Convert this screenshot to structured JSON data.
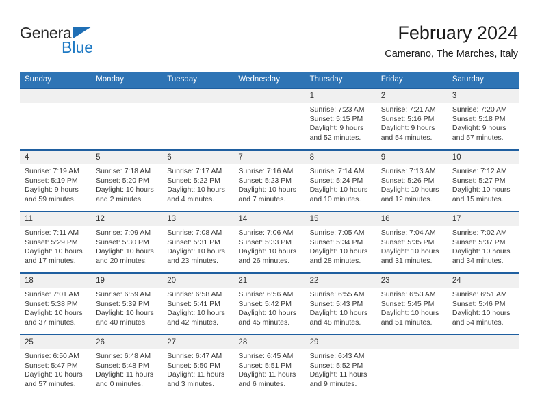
{
  "brand": {
    "line1": "General",
    "line2": "Blue",
    "triangle_icon": "triangle-icon",
    "color_dark": "#2b2b2b",
    "color_blue": "#1f7ac4"
  },
  "header": {
    "title": "February 2024",
    "subtitle": "Camerano, The Marches, Italy"
  },
  "colors": {
    "header_band": "#2e74b5",
    "week_separator": "#1f5fa0",
    "daynum_band": "#f0f0f0",
    "text": "#3a3a3a"
  },
  "weekdays": [
    "Sunday",
    "Monday",
    "Tuesday",
    "Wednesday",
    "Thursday",
    "Friday",
    "Saturday"
  ],
  "weeks": [
    [
      {
        "day": "",
        "empty": true
      },
      {
        "day": "",
        "empty": true
      },
      {
        "day": "",
        "empty": true
      },
      {
        "day": "",
        "empty": true
      },
      {
        "day": "1",
        "sunrise": "Sunrise: 7:23 AM",
        "sunset": "Sunset: 5:15 PM",
        "daylight1": "Daylight: 9 hours",
        "daylight2": "and 52 minutes."
      },
      {
        "day": "2",
        "sunrise": "Sunrise: 7:21 AM",
        "sunset": "Sunset: 5:16 PM",
        "daylight1": "Daylight: 9 hours",
        "daylight2": "and 54 minutes."
      },
      {
        "day": "3",
        "sunrise": "Sunrise: 7:20 AM",
        "sunset": "Sunset: 5:18 PM",
        "daylight1": "Daylight: 9 hours",
        "daylight2": "and 57 minutes."
      }
    ],
    [
      {
        "day": "4",
        "sunrise": "Sunrise: 7:19 AM",
        "sunset": "Sunset: 5:19 PM",
        "daylight1": "Daylight: 9 hours",
        "daylight2": "and 59 minutes."
      },
      {
        "day": "5",
        "sunrise": "Sunrise: 7:18 AM",
        "sunset": "Sunset: 5:20 PM",
        "daylight1": "Daylight: 10 hours",
        "daylight2": "and 2 minutes."
      },
      {
        "day": "6",
        "sunrise": "Sunrise: 7:17 AM",
        "sunset": "Sunset: 5:22 PM",
        "daylight1": "Daylight: 10 hours",
        "daylight2": "and 4 minutes."
      },
      {
        "day": "7",
        "sunrise": "Sunrise: 7:16 AM",
        "sunset": "Sunset: 5:23 PM",
        "daylight1": "Daylight: 10 hours",
        "daylight2": "and 7 minutes."
      },
      {
        "day": "8",
        "sunrise": "Sunrise: 7:14 AM",
        "sunset": "Sunset: 5:24 PM",
        "daylight1": "Daylight: 10 hours",
        "daylight2": "and 10 minutes."
      },
      {
        "day": "9",
        "sunrise": "Sunrise: 7:13 AM",
        "sunset": "Sunset: 5:26 PM",
        "daylight1": "Daylight: 10 hours",
        "daylight2": "and 12 minutes."
      },
      {
        "day": "10",
        "sunrise": "Sunrise: 7:12 AM",
        "sunset": "Sunset: 5:27 PM",
        "daylight1": "Daylight: 10 hours",
        "daylight2": "and 15 minutes."
      }
    ],
    [
      {
        "day": "11",
        "sunrise": "Sunrise: 7:11 AM",
        "sunset": "Sunset: 5:29 PM",
        "daylight1": "Daylight: 10 hours",
        "daylight2": "and 17 minutes."
      },
      {
        "day": "12",
        "sunrise": "Sunrise: 7:09 AM",
        "sunset": "Sunset: 5:30 PM",
        "daylight1": "Daylight: 10 hours",
        "daylight2": "and 20 minutes."
      },
      {
        "day": "13",
        "sunrise": "Sunrise: 7:08 AM",
        "sunset": "Sunset: 5:31 PM",
        "daylight1": "Daylight: 10 hours",
        "daylight2": "and 23 minutes."
      },
      {
        "day": "14",
        "sunrise": "Sunrise: 7:06 AM",
        "sunset": "Sunset: 5:33 PM",
        "daylight1": "Daylight: 10 hours",
        "daylight2": "and 26 minutes."
      },
      {
        "day": "15",
        "sunrise": "Sunrise: 7:05 AM",
        "sunset": "Sunset: 5:34 PM",
        "daylight1": "Daylight: 10 hours",
        "daylight2": "and 28 minutes."
      },
      {
        "day": "16",
        "sunrise": "Sunrise: 7:04 AM",
        "sunset": "Sunset: 5:35 PM",
        "daylight1": "Daylight: 10 hours",
        "daylight2": "and 31 minutes."
      },
      {
        "day": "17",
        "sunrise": "Sunrise: 7:02 AM",
        "sunset": "Sunset: 5:37 PM",
        "daylight1": "Daylight: 10 hours",
        "daylight2": "and 34 minutes."
      }
    ],
    [
      {
        "day": "18",
        "sunrise": "Sunrise: 7:01 AM",
        "sunset": "Sunset: 5:38 PM",
        "daylight1": "Daylight: 10 hours",
        "daylight2": "and 37 minutes."
      },
      {
        "day": "19",
        "sunrise": "Sunrise: 6:59 AM",
        "sunset": "Sunset: 5:39 PM",
        "daylight1": "Daylight: 10 hours",
        "daylight2": "and 40 minutes."
      },
      {
        "day": "20",
        "sunrise": "Sunrise: 6:58 AM",
        "sunset": "Sunset: 5:41 PM",
        "daylight1": "Daylight: 10 hours",
        "daylight2": "and 42 minutes."
      },
      {
        "day": "21",
        "sunrise": "Sunrise: 6:56 AM",
        "sunset": "Sunset: 5:42 PM",
        "daylight1": "Daylight: 10 hours",
        "daylight2": "and 45 minutes."
      },
      {
        "day": "22",
        "sunrise": "Sunrise: 6:55 AM",
        "sunset": "Sunset: 5:43 PM",
        "daylight1": "Daylight: 10 hours",
        "daylight2": "and 48 minutes."
      },
      {
        "day": "23",
        "sunrise": "Sunrise: 6:53 AM",
        "sunset": "Sunset: 5:45 PM",
        "daylight1": "Daylight: 10 hours",
        "daylight2": "and 51 minutes."
      },
      {
        "day": "24",
        "sunrise": "Sunrise: 6:51 AM",
        "sunset": "Sunset: 5:46 PM",
        "daylight1": "Daylight: 10 hours",
        "daylight2": "and 54 minutes."
      }
    ],
    [
      {
        "day": "25",
        "sunrise": "Sunrise: 6:50 AM",
        "sunset": "Sunset: 5:47 PM",
        "daylight1": "Daylight: 10 hours",
        "daylight2": "and 57 minutes."
      },
      {
        "day": "26",
        "sunrise": "Sunrise: 6:48 AM",
        "sunset": "Sunset: 5:48 PM",
        "daylight1": "Daylight: 11 hours",
        "daylight2": "and 0 minutes."
      },
      {
        "day": "27",
        "sunrise": "Sunrise: 6:47 AM",
        "sunset": "Sunset: 5:50 PM",
        "daylight1": "Daylight: 11 hours",
        "daylight2": "and 3 minutes."
      },
      {
        "day": "28",
        "sunrise": "Sunrise: 6:45 AM",
        "sunset": "Sunset: 5:51 PM",
        "daylight1": "Daylight: 11 hours",
        "daylight2": "and 6 minutes."
      },
      {
        "day": "29",
        "sunrise": "Sunrise: 6:43 AM",
        "sunset": "Sunset: 5:52 PM",
        "daylight1": "Daylight: 11 hours",
        "daylight2": "and 9 minutes."
      },
      {
        "day": "",
        "empty": true
      },
      {
        "day": "",
        "empty": true
      }
    ]
  ]
}
